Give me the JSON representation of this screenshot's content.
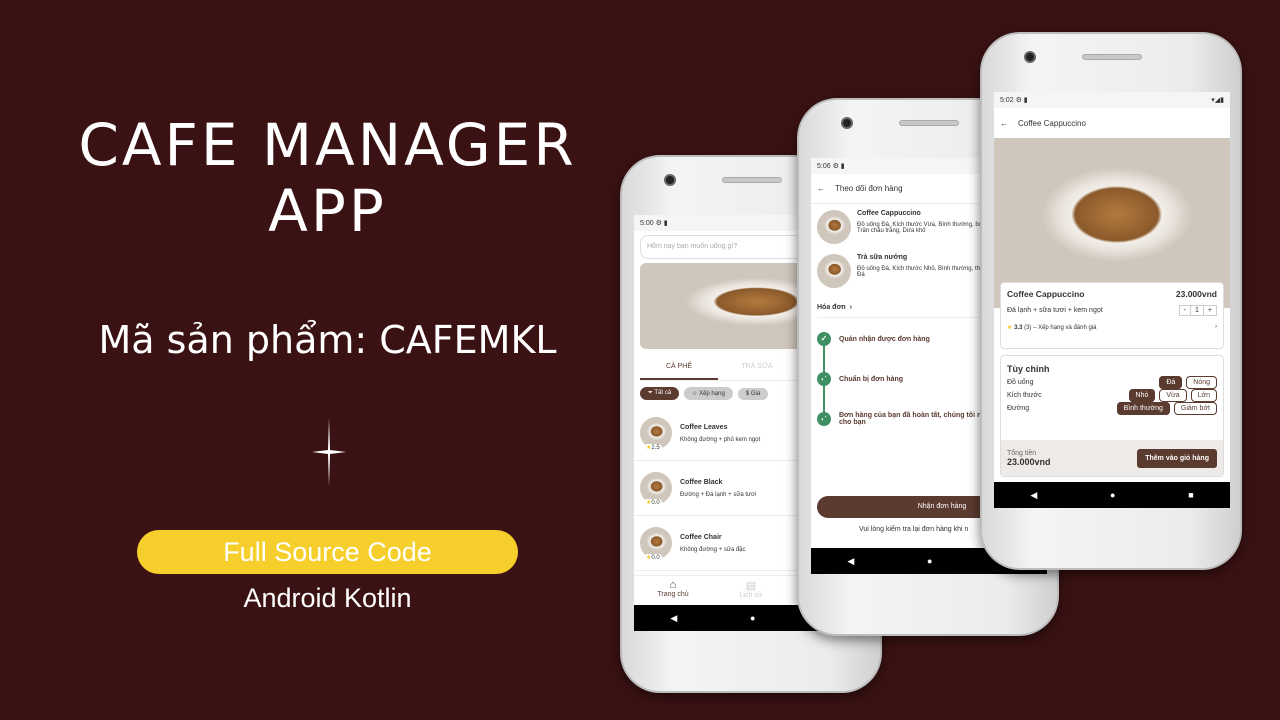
{
  "hero": {
    "title_line1": "CAFE MANAGER",
    "title_line2": "APP",
    "product_code": "Mã sản phẩm: CAFEMKL",
    "badge": "Full Source Code",
    "platform": "Android Kotlin"
  },
  "colors": {
    "background": "#3b1213",
    "badge": "#f6cf2c",
    "brand": "#5b3a30",
    "success": "#3f8f62"
  },
  "home": {
    "time": "5:00",
    "search_placeholder": "Hôm nay bạn muốn uống gì?",
    "tabs": [
      "CÀ PHÊ",
      "TRÀ SỮA"
    ],
    "filters": [
      "Tất cả",
      "Xếp hạng",
      "Giá"
    ],
    "items": [
      {
        "name": "Coffee Leaves",
        "desc": "Không đường + phủ kem ngọt",
        "rating": "2.5"
      },
      {
        "name": "Coffee Black",
        "desc": "Đường + Đá lạnh + sữa tươi",
        "rating": "0.0"
      },
      {
        "name": "Coffee Chair",
        "desc": "Không đường + sữa đặc",
        "rating": "0.0"
      }
    ],
    "bottom_nav": [
      "Trang chủ",
      "Lịch sử"
    ]
  },
  "tracking": {
    "time": "5:06",
    "title": "Theo dõi đơn hàng",
    "items": [
      {
        "name": "Coffee Cappuccino",
        "desc": "Đồ uống Đá, Kích thước Vừa, Bình thường, bớt Đá, Trân châu trắng, Dừa khô"
      },
      {
        "name": "Trà sữa nướng",
        "desc": "Đồ uống Đá, Kích thước Nhỏ, Bình thường, thường Đá"
      }
    ],
    "invoice": "Hóa đơn",
    "steps": [
      "Quán nhận được đơn hàng",
      "Chuẩn bị đơn hàng",
      "Đơn hàng của bạn đã hoàn tất, chúng tôi ngay cho bạn"
    ],
    "receive_button": "Nhận đơn hàng",
    "note": "Vui lòng kiểm tra lại đơn hàng khi n"
  },
  "detail": {
    "time": "5:02",
    "title": "Coffee Cappuccino",
    "name": "Coffee Cappuccino",
    "price": "23.000vnd",
    "desc": "Đá lạnh + sữa tươi + kem ngọt",
    "qty_minus": "-",
    "qty": "1",
    "qty_plus": "+",
    "rating": "3.3",
    "rating_count": "(3)",
    "rating_link": "Xếp hạng và đánh giá",
    "custom_title": "Tùy chỉnh",
    "options": [
      {
        "label": "Đồ uống",
        "choices": [
          "Đá",
          "Nóng"
        ],
        "selected": 0
      },
      {
        "label": "Kích thước",
        "choices": [
          "Nhỏ",
          "Vừa",
          "Lớn"
        ],
        "selected": 0
      },
      {
        "label": "Đường",
        "choices": [
          "Bình thường",
          "Giảm bớt"
        ],
        "selected": 0
      }
    ],
    "total_label": "Tổng tiền",
    "total": "23.000vnd",
    "add_button": "Thêm vào giỏ hàng"
  }
}
